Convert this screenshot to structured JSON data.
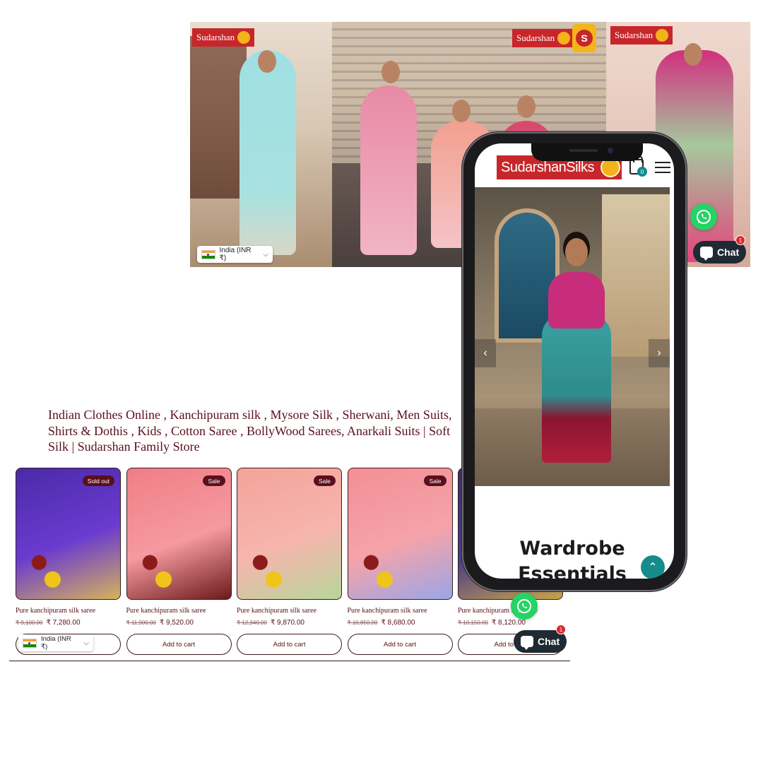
{
  "hero": {
    "brand": "Sudarshan",
    "s_mark": "S",
    "currency": "India (INR ₹)"
  },
  "chat": {
    "label": "Chat",
    "unread": "1"
  },
  "page_title": "Indian Clothes Online , Kanchipuram silk , Mysore Silk , Sherwani, Men Suits, Shirts & Dothis , Kids , Cotton Saree , BollyWood Sarees, Anarkali Suits | Soft Silk | Sudarshan Family Store",
  "products": [
    {
      "badge": "Sold out",
      "name": "Pure kanchipuram silk saree",
      "old_price": "₹ 9,100.00",
      "price": "₹ 7,280.00",
      "button": "Add to cart",
      "colors": [
        "#4a2aa8",
        "#6a3bd0",
        "#d6b25a"
      ]
    },
    {
      "badge": "Sale",
      "name": "Pure kanchipuram silk saree",
      "old_price": "₹ 11,900.00",
      "price": "₹ 9,520.00",
      "button": "Add to cart",
      "colors": [
        "#f07d86",
        "#f59aa0",
        "#6b1a1a"
      ]
    },
    {
      "badge": "Sale",
      "name": "Pure kanchipuram silk saree",
      "old_price": "₹ 12,340.00",
      "price": "₹ 9,870.00",
      "button": "Add to cart",
      "colors": [
        "#f3a39a",
        "#f6b5ad",
        "#b8d69a"
      ]
    },
    {
      "badge": "Sale",
      "name": "Pure kanchipuram silk saree",
      "old_price": "₹ 10,850.00",
      "price": "₹ 8,680.00",
      "button": "Add to cart",
      "colors": [
        "#f38e96",
        "#f5a3a9",
        "#9aa6e8"
      ]
    },
    {
      "badge": "",
      "name": "Pure kanchipuram silk saree",
      "old_price": "₹ 10,150.00",
      "price": "₹ 8,120.00",
      "button": "Add to cart",
      "colors": [
        "#3a2f6a",
        "#4b3d85",
        "#c9a34a"
      ]
    }
  ],
  "mobile": {
    "logo": "SudarshanSilks",
    "cart_count": "0",
    "heading": "Wardrobe Essentials",
    "prev": "‹",
    "next": "›",
    "scroll_top": "⌃"
  },
  "colors": {
    "brand_red": "#c7262a",
    "text_maroon": "#5a0f1c",
    "whatsapp": "#25d366",
    "chat_bg": "#1f2a33",
    "teal": "#168b8b"
  }
}
